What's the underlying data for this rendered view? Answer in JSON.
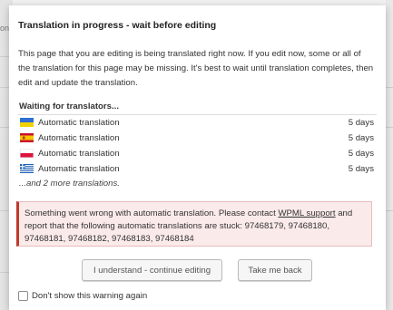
{
  "background": {
    "left_fragment": "on"
  },
  "dialog": {
    "title": "Translation in progress - wait before editing",
    "intro": "This page that you are editing is being translated right now. If you edit now, some or all of the translation for this page may be missing. It's best to wait until translation completes, then edit and update the translation.",
    "waiting_heading": "Waiting for translators...",
    "languages": [
      {
        "flag": "ukraine-flag-icon",
        "label": "Automatic translation",
        "days": "5 days"
      },
      {
        "flag": "spain-flag-icon",
        "label": "Automatic translation",
        "days": "5 days"
      },
      {
        "flag": "poland-flag-icon",
        "label": "Automatic translation",
        "days": "5 days"
      },
      {
        "flag": "greece-flag-icon",
        "label": "Automatic translation",
        "days": "5 days"
      }
    ],
    "more_text": "...and 2 more translations.",
    "error": {
      "before_link": "Something went wrong with automatic translation. Please contact ",
      "link_text": "WPML support",
      "after_link": " and report that the following automatic translations are stuck: 97468179, 97468180, 97468181, 97468182, 97468183, 97468184"
    },
    "buttons": {
      "continue": "I understand - continue editing",
      "back": "Take me back"
    },
    "dont_show_label": "Don't show this warning again"
  },
  "colors": {
    "error_accent": "#c0392b",
    "error_background": "#fbeaea"
  }
}
